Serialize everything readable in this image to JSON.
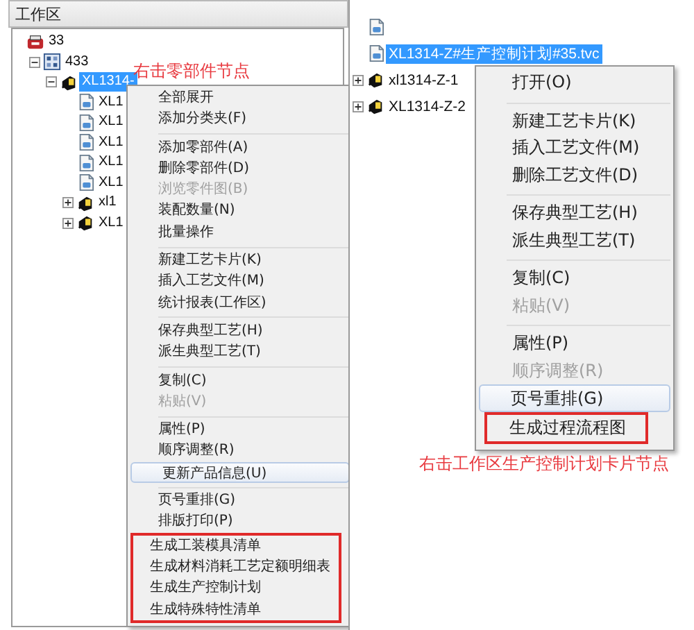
{
  "left_panel": {
    "title": "工作区",
    "tree": [
      {
        "kind": "root",
        "label": "33",
        "children": [
          {
            "kind": "assembly",
            "label": "433",
            "expanded": true,
            "children": [
              {
                "kind": "part",
                "label": "XL1314-",
                "expanded": true,
                "selected": true,
                "children": [
                  {
                    "kind": "file",
                    "label": "XL1",
                    "selected": false
                  },
                  {
                    "kind": "file",
                    "label": "XL1",
                    "selected": false
                  },
                  {
                    "kind": "file",
                    "label": "XL1",
                    "selected": false
                  },
                  {
                    "kind": "file",
                    "label": "XL1",
                    "selected": false
                  },
                  {
                    "kind": "file",
                    "label": "XL1",
                    "selected": false
                  },
                  {
                    "kind": "part",
                    "label": "xl1",
                    "expanded": false,
                    "selected": false
                  },
                  {
                    "kind": "part",
                    "label": "XL1",
                    "expanded": false,
                    "selected": false
                  }
                ]
              }
            ]
          }
        ]
      }
    ],
    "annotation": "右击零部件节点",
    "context_menu": {
      "items": [
        {
          "kind": "item",
          "label": "全部展开",
          "disabled": false,
          "hovered": false,
          "boxed": false
        },
        {
          "kind": "item",
          "label": "添加分类夹(F)",
          "disabled": false,
          "hovered": false,
          "boxed": false
        },
        {
          "kind": "separator"
        },
        {
          "kind": "item",
          "label": "添加零部件(A)",
          "disabled": false,
          "hovered": false,
          "boxed": false
        },
        {
          "kind": "item",
          "label": "删除零部件(D)",
          "disabled": false,
          "hovered": false,
          "boxed": false
        },
        {
          "kind": "item",
          "label": "浏览零件图(B)",
          "disabled": true,
          "hovered": false,
          "boxed": false
        },
        {
          "kind": "item",
          "label": "装配数量(N)",
          "disabled": false,
          "hovered": false,
          "boxed": false
        },
        {
          "kind": "item",
          "label": "批量操作",
          "disabled": false,
          "hovered": false,
          "boxed": false
        },
        {
          "kind": "separator"
        },
        {
          "kind": "item",
          "label": "新建工艺卡片(K)",
          "disabled": false,
          "hovered": false,
          "boxed": false
        },
        {
          "kind": "item",
          "label": "插入工艺文件(M)",
          "disabled": false,
          "hovered": false,
          "boxed": false
        },
        {
          "kind": "item",
          "label": "统计报表(工作区)",
          "disabled": false,
          "hovered": false,
          "boxed": false
        },
        {
          "kind": "separator"
        },
        {
          "kind": "item",
          "label": "保存典型工艺(H)",
          "disabled": false,
          "hovered": false,
          "boxed": false
        },
        {
          "kind": "item",
          "label": "派生典型工艺(T)",
          "disabled": false,
          "hovered": false,
          "boxed": false
        },
        {
          "kind": "separator"
        },
        {
          "kind": "item",
          "label": "复制(C)",
          "disabled": false,
          "hovered": false,
          "boxed": false
        },
        {
          "kind": "item",
          "label": "粘贴(V)",
          "disabled": true,
          "hovered": false,
          "boxed": false
        },
        {
          "kind": "separator"
        },
        {
          "kind": "item",
          "label": "属性(P)",
          "disabled": false,
          "hovered": false,
          "boxed": false
        },
        {
          "kind": "item",
          "label": "顺序调整(R)",
          "disabled": false,
          "hovered": false,
          "boxed": false
        },
        {
          "kind": "item",
          "label": "更新产品信息(U)",
          "disabled": false,
          "hovered": true,
          "boxed": false
        },
        {
          "kind": "separator"
        },
        {
          "kind": "item",
          "label": "页号重排(G)",
          "disabled": false,
          "hovered": false,
          "boxed": false
        },
        {
          "kind": "item",
          "label": "排版打印(P)",
          "disabled": false,
          "hovered": false,
          "boxed": false
        },
        {
          "kind": "item",
          "label": "生成工装模具清单",
          "disabled": false,
          "hovered": false,
          "boxed": true
        },
        {
          "kind": "item",
          "label": "生成材料消耗工艺定额明细表",
          "disabled": false,
          "hovered": false,
          "boxed": true
        },
        {
          "kind": "item",
          "label": "生成生产控制计划",
          "disabled": false,
          "hovered": false,
          "boxed": true
        },
        {
          "kind": "item",
          "label": "生成特殊特性清单",
          "disabled": false,
          "hovered": false,
          "boxed": true
        }
      ]
    }
  },
  "right_panel": {
    "tree": [
      {
        "kind": "file"
      },
      {
        "kind": "file",
        "label": "XL1314-Z#生产控制计划#35.tvc",
        "selected": true
      },
      {
        "kind": "part",
        "label": "xl1314-Z-1",
        "expanded": false,
        "selected": false
      },
      {
        "kind": "part",
        "label": "XL1314-Z-2",
        "expanded": false,
        "selected": false
      }
    ],
    "annotation": "右击工作区生产控制计划卡片节点",
    "context_menu": {
      "items": [
        {
          "kind": "item",
          "label": "打开(O)",
          "disabled": false,
          "hovered": false,
          "boxed": false
        },
        {
          "kind": "separator"
        },
        {
          "kind": "item",
          "label": "新建工艺卡片(K)",
          "disabled": false,
          "hovered": false,
          "boxed": false
        },
        {
          "kind": "item",
          "label": "插入工艺文件(M)",
          "disabled": false,
          "hovered": false,
          "boxed": false
        },
        {
          "kind": "item",
          "label": "删除工艺文件(D)",
          "disabled": false,
          "hovered": false,
          "boxed": false
        },
        {
          "kind": "separator"
        },
        {
          "kind": "item",
          "label": "保存典型工艺(H)",
          "disabled": false,
          "hovered": false,
          "boxed": false
        },
        {
          "kind": "item",
          "label": "派生典型工艺(T)",
          "disabled": false,
          "hovered": false,
          "boxed": false
        },
        {
          "kind": "separator"
        },
        {
          "kind": "item",
          "label": "复制(C)",
          "disabled": false,
          "hovered": false,
          "boxed": false
        },
        {
          "kind": "item",
          "label": "粘贴(V)",
          "disabled": true,
          "hovered": false,
          "boxed": false
        },
        {
          "kind": "separator"
        },
        {
          "kind": "item",
          "label": "属性(P)",
          "disabled": false,
          "hovered": false,
          "boxed": false
        },
        {
          "kind": "item",
          "label": "顺序调整(R)",
          "disabled": true,
          "hovered": false,
          "boxed": false
        },
        {
          "kind": "item",
          "label": "页号重排(G)",
          "disabled": false,
          "hovered": true,
          "boxed": false
        },
        {
          "kind": "item",
          "label": "生成过程流程图",
          "disabled": false,
          "hovered": false,
          "boxed": true
        }
      ]
    }
  }
}
